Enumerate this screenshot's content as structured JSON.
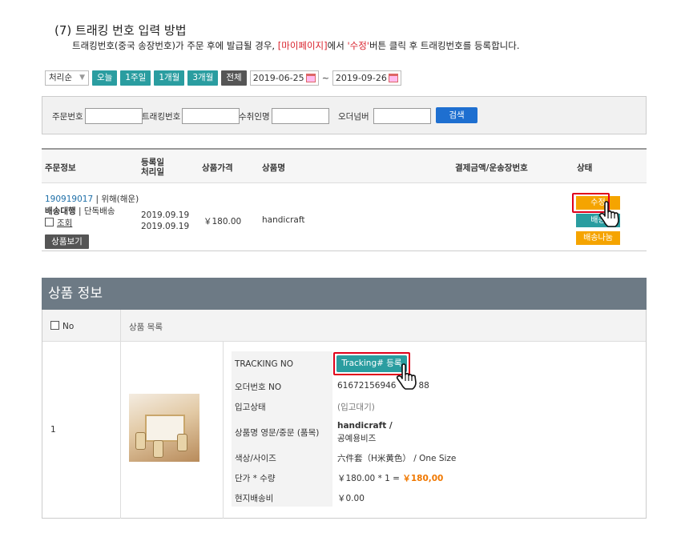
{
  "heading": "(7) 트래킹 번호 입력 방법",
  "description": {
    "part1": "트래킹번호(중국 송장번호)가 주문 후에 발급될 경우, ",
    "mypage": "[마이페이지]",
    "part2": "에서 ",
    "edit_word": "'수정'",
    "part3": "버튼 클릭 후 트래킹번호를 등록합니다."
  },
  "filter": {
    "sort_select": "처리순",
    "periods": [
      "오늘",
      "1주일",
      "1개월",
      "3개월",
      "전체"
    ],
    "date_from": "2019-06-25",
    "date_to": "2019-09-26",
    "date_sep": "~"
  },
  "search": {
    "order_no_label": "주문번호",
    "tracking_label": "트래킹번호",
    "receiver_label": "수취인명",
    "order_number_label": "오더넘버",
    "search_button": "검색"
  },
  "order_table": {
    "headers": {
      "order_info": "주문정보",
      "dates_line1": "등록일",
      "dates_line2": "처리일",
      "price": "상품가격",
      "product_name": "상품명",
      "payment": "결제금액/운송장번호",
      "status": "상태"
    },
    "row": {
      "order_id": "190919017",
      "order_type": " | 위해(해운)",
      "shipping_agent": "배송대행",
      "shipping_type": " | 단독배송",
      "lookup_label": "조회",
      "view_product_button": "상품보기",
      "registered_date": "2019.09.19",
      "processed_date": "2019.09.19",
      "price": "￥180.00",
      "product": "handicraft",
      "status_buttons": [
        "수정",
        "배송",
        "배송나눔"
      ]
    }
  },
  "product_info": {
    "title": "상품 정보",
    "col_no": "No",
    "col_list": "상품 목록",
    "row_no": "1",
    "fields": {
      "tracking_label": "TRACKING NO",
      "tracking_button": "Tracking# 등록",
      "order_no_label": "오더번호 NO",
      "order_no_value": "61672156946",
      "order_no_suffix": "88",
      "stock_label": "입고상태",
      "stock_value": "(입고대기)",
      "name_label": "상품명 영문/중문 (품목)",
      "name_en": "handicraft /",
      "name_category": "공예용비즈",
      "color_label": "색상/사이즈",
      "color_value": "六件套（H米黄色） / One Size",
      "qty_label": "단가 * 수량",
      "qty_value": "￥180.00  *  1  =",
      "qty_total": "￥180,00",
      "local_ship_label": "현지배송비",
      "local_ship_value": "￥0.00"
    }
  },
  "colors": {
    "teal": "#2a9da0",
    "orange": "#f5a400",
    "highlight_red": "#e0001a",
    "header_gray": "#6d7a85",
    "search_blue": "#1e6fd0"
  }
}
